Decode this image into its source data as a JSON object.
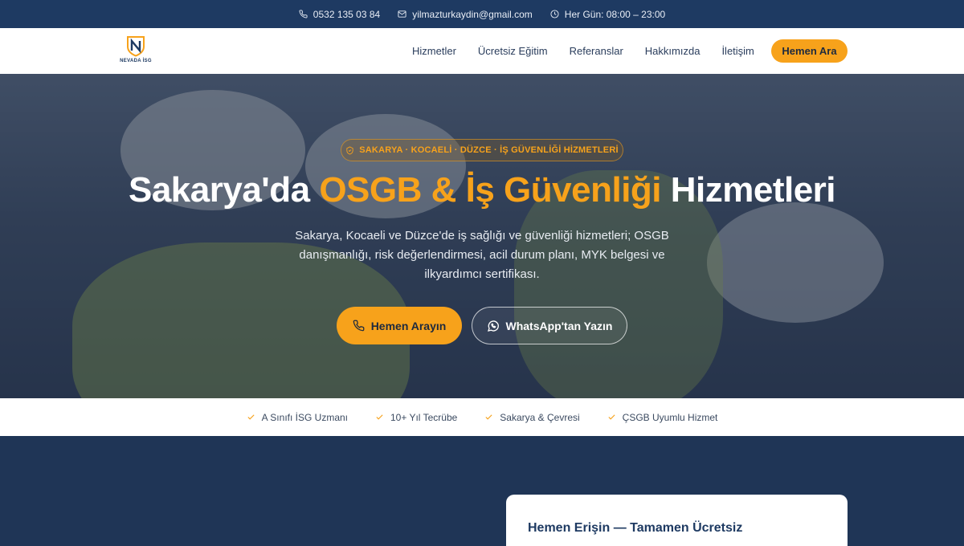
{
  "topbar": {
    "phone": "0532 135 03 84",
    "email": "yilmazturkaydin@gmail.com",
    "hours": "Her Gün: 08:00 – 23:00"
  },
  "brand": {
    "name": "NEVADA İSG"
  },
  "nav": {
    "items": [
      {
        "label": "Hizmetler"
      },
      {
        "label": "Ücretsiz Eğitim"
      },
      {
        "label": "Referanslar"
      },
      {
        "label": "Hakkımızda"
      },
      {
        "label": "İletişim"
      }
    ],
    "cta": "Hemen Ara"
  },
  "hero": {
    "badge": "SAKARYA · KOCAELİ · DÜZCE · İŞ GÜVENLİĞİ HİZMETLERİ",
    "title_prefix": "Sakarya'da ",
    "title_accent": "OSGB & İş Güvenliği",
    "title_suffix": " Hizmetleri",
    "description": "Sakarya, Kocaeli ve Düzce'de iş sağlığı ve güvenliği hizmetleri; OSGB danışmanlığı, risk değerlendirmesi, acil durum planı, MYK belgesi ve ilkyardımcı sertifikası.",
    "primary_button": "Hemen Arayın",
    "secondary_button": "WhatsApp'tan Yazın"
  },
  "features": [
    {
      "label": "A Sınıfı İSG Uzmanı"
    },
    {
      "label": "10+ Yıl Tecrübe"
    },
    {
      "label": "Sakarya & Çevresi"
    },
    {
      "label": "ÇSGB Uyumlu Hizmet"
    }
  ],
  "card": {
    "title": "Hemen Erişin — Tamamen Ücretsiz"
  },
  "colors": {
    "accent": "#f7a21b",
    "navy": "#1e3a62",
    "dark_section": "#1f3556"
  }
}
